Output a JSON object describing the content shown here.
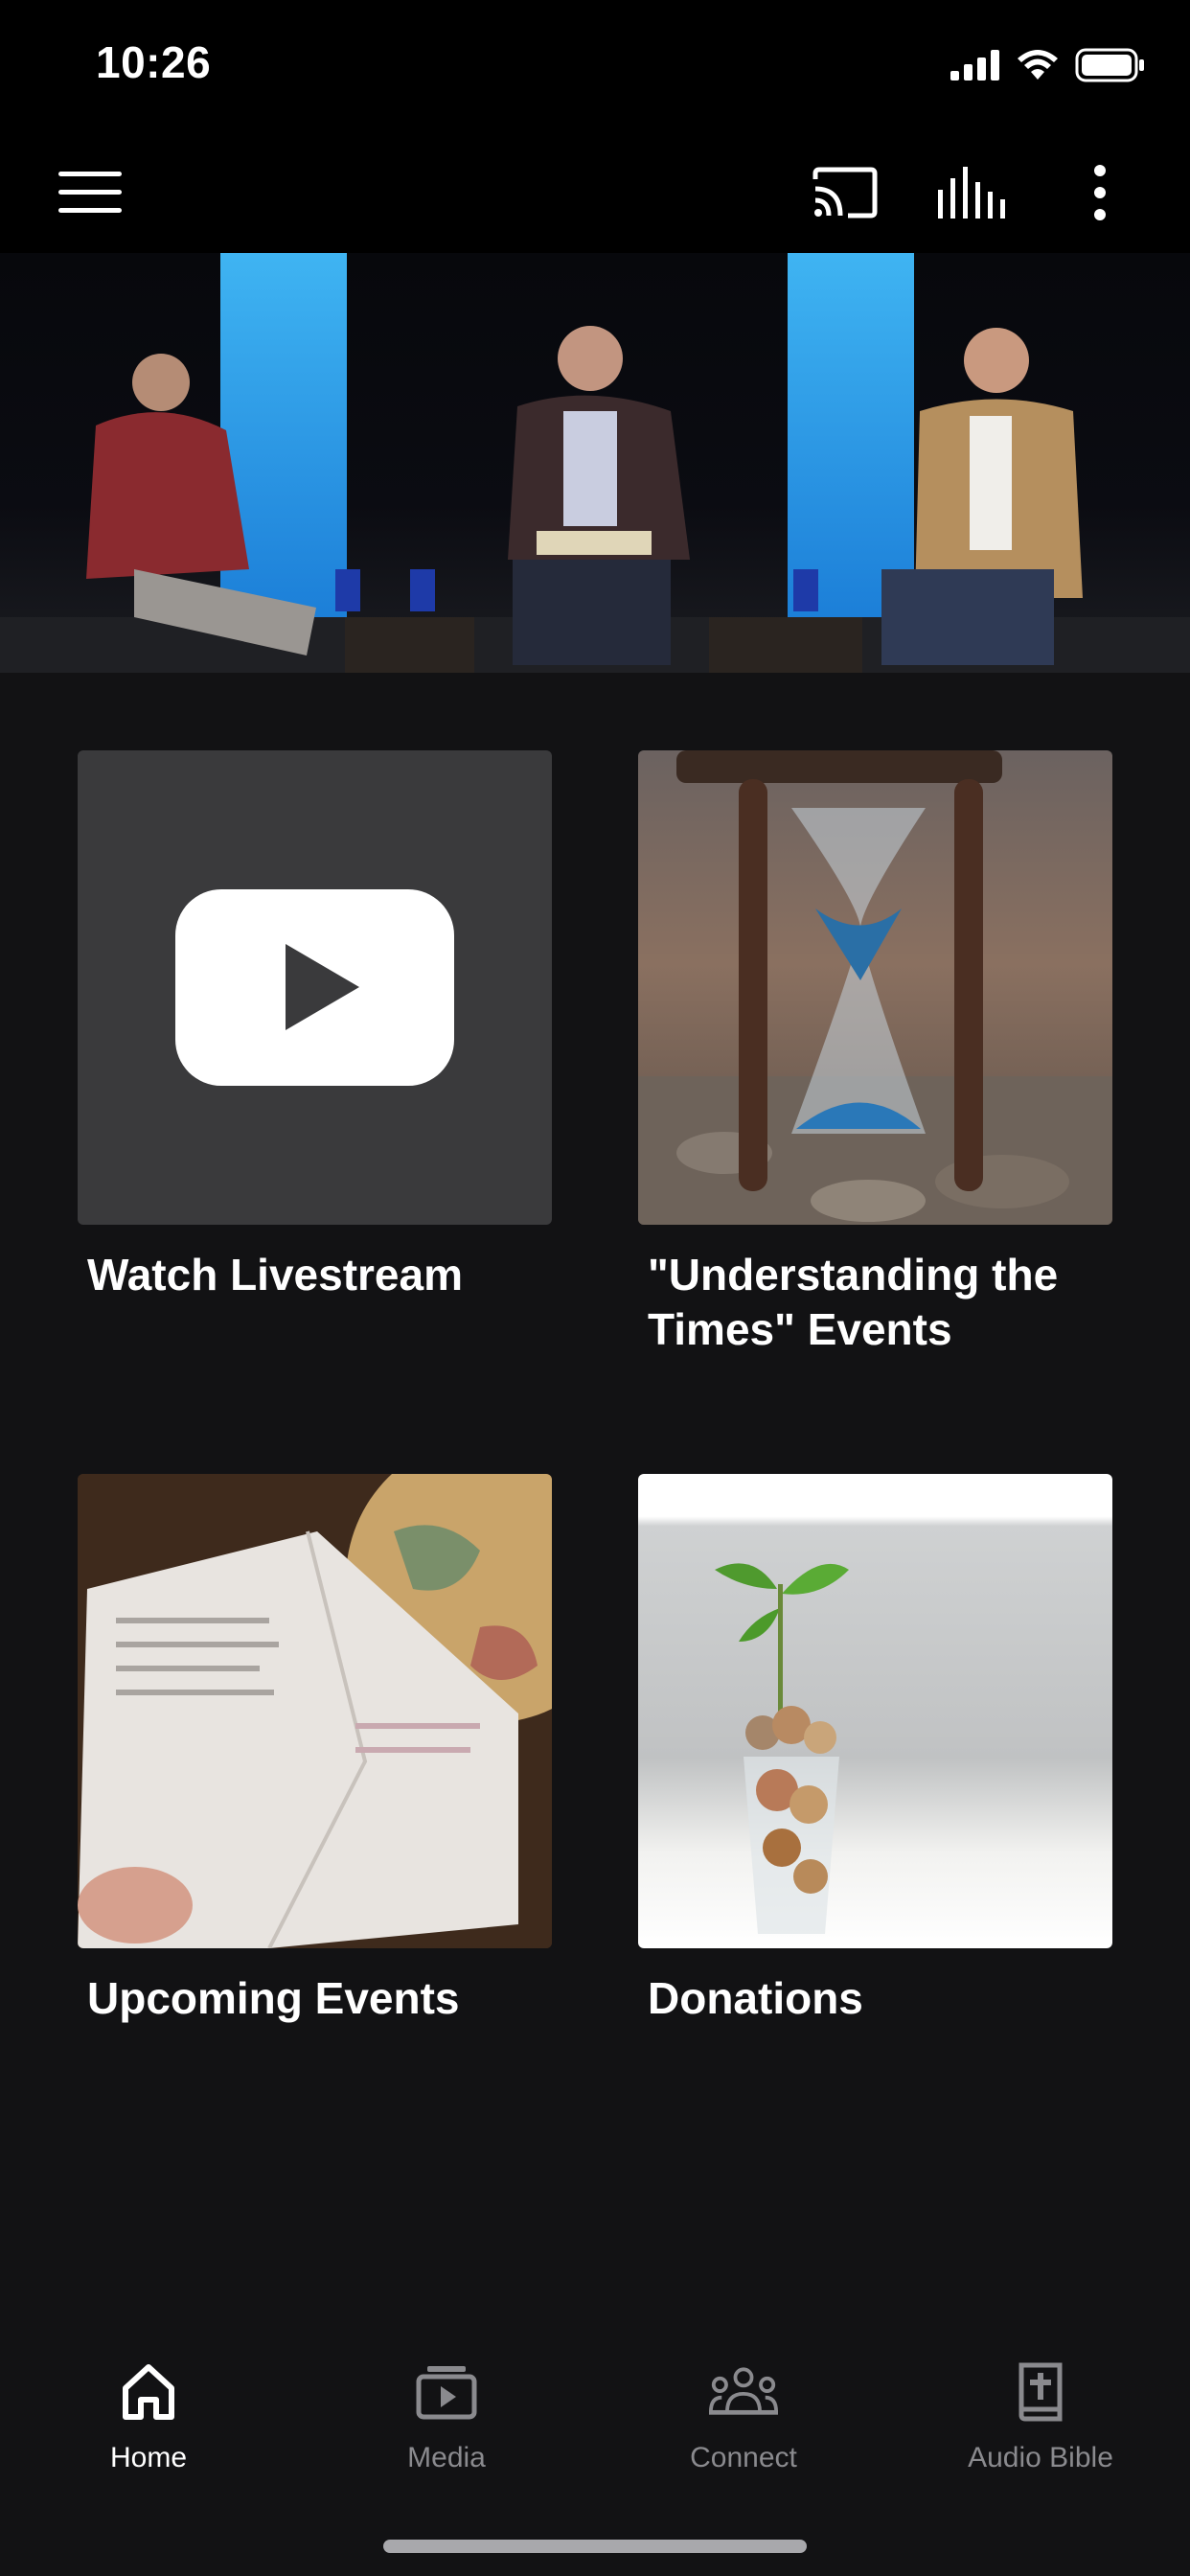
{
  "status_bar": {
    "time": "10:26"
  },
  "toolbar": {
    "icons": [
      "menu-icon",
      "cast-icon",
      "audio-bars-icon",
      "more-vert-icon"
    ]
  },
  "tiles": [
    {
      "label": "Watch Livestream",
      "icon": "youtube-play-icon"
    },
    {
      "label": "\"Understanding the Times\" Events",
      "icon": "hourglass-image"
    },
    {
      "label": "Upcoming Events",
      "icon": "bible-globe-image"
    },
    {
      "label": "Donations",
      "icon": "coin-jar-plant-image"
    }
  ],
  "bottom_nav": {
    "items": [
      {
        "label": "Home",
        "icon": "home-icon",
        "active": true
      },
      {
        "label": "Media",
        "icon": "media-icon",
        "active": false
      },
      {
        "label": "Connect",
        "icon": "connect-icon",
        "active": false
      },
      {
        "label": "Audio Bible",
        "icon": "bible-icon",
        "active": false
      }
    ]
  },
  "colors": {
    "background": "#121214",
    "bar": "#000000",
    "inactive": "#8a8a8e",
    "active": "#ffffff"
  }
}
